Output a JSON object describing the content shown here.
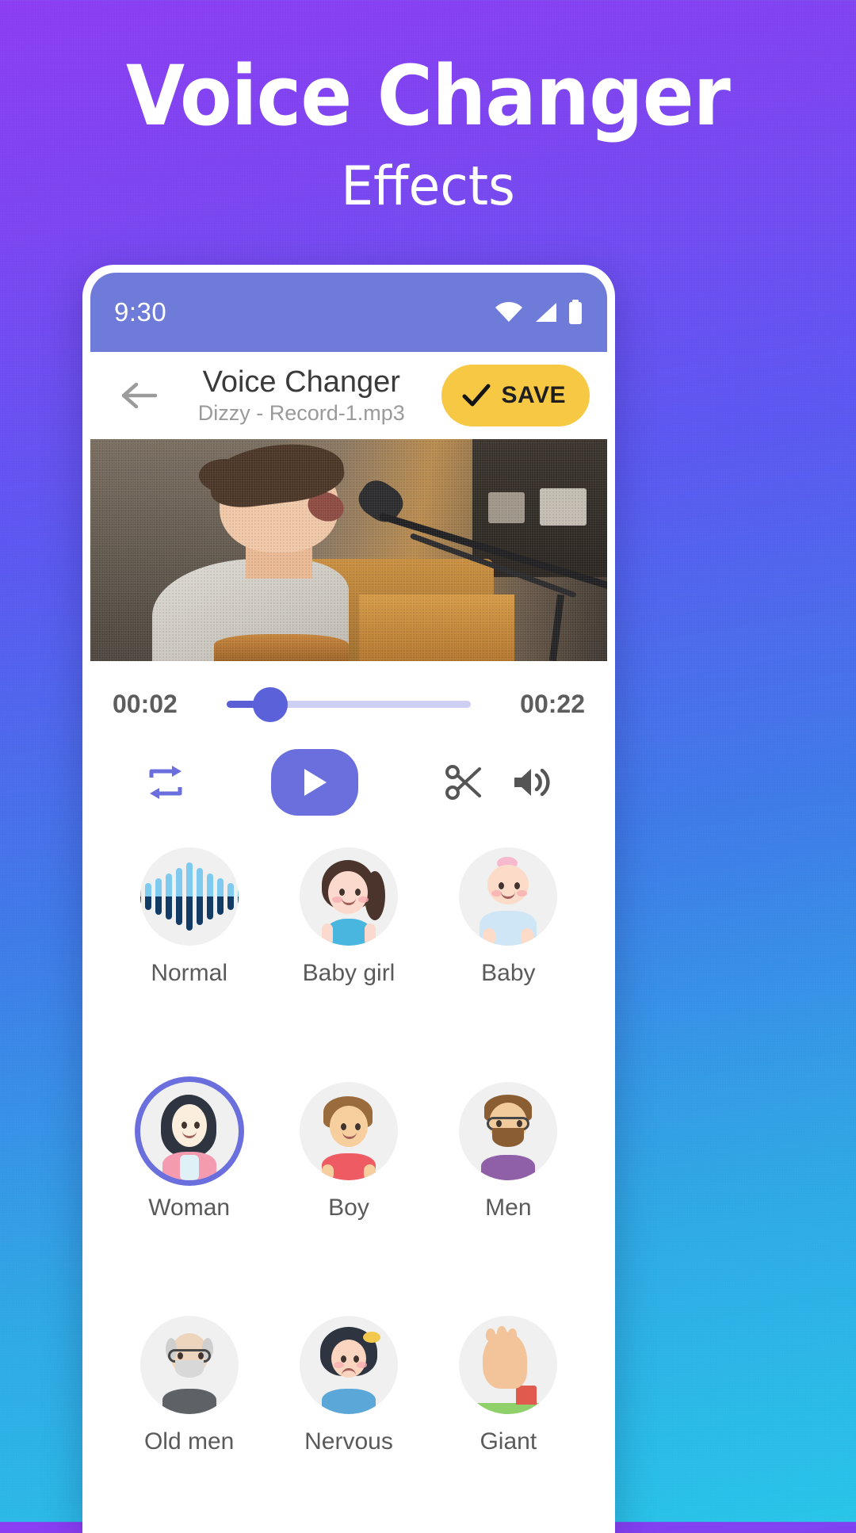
{
  "promo": {
    "title": "Voice Changer",
    "subtitle": "Effects"
  },
  "colors": {
    "bg_top": "#8b3df2",
    "bg_bottom": "#27c4e8",
    "accent_purple": "#6b6fdd",
    "save_yellow": "#f7c843",
    "status_bar": "#6f7bd8",
    "track_filled": "#5a5fd6",
    "track_empty": "#cdd0f3"
  },
  "status_bar": {
    "time": "9:30",
    "icons": [
      "wifi-icon",
      "signal-icon",
      "battery-icon"
    ]
  },
  "appbar": {
    "back_icon": "back-arrow-icon",
    "title": "Voice Changer",
    "subtitle": "Dizzy - Record-1.mp3",
    "save_label": "SAVE",
    "save_icon": "check-icon"
  },
  "player": {
    "current_time": "00:02",
    "total_time": "00:22",
    "progress_percent": 18,
    "controls": [
      {
        "name": "repeat-button",
        "icon": "repeat-icon"
      },
      {
        "name": "play-button",
        "icon": "play-icon"
      },
      {
        "name": "trim-button",
        "icon": "scissors-icon"
      },
      {
        "name": "volume-button",
        "icon": "volume-icon"
      }
    ]
  },
  "effects": {
    "selected": "Woman",
    "items": [
      {
        "label": "Normal",
        "icon": "waveform-icon",
        "selected": false
      },
      {
        "label": "Baby girl",
        "icon": "baby-girl-icon",
        "selected": false
      },
      {
        "label": "Baby",
        "icon": "baby-icon",
        "selected": false
      },
      {
        "label": "Woman",
        "icon": "woman-icon",
        "selected": true
      },
      {
        "label": "Boy",
        "icon": "boy-icon",
        "selected": false
      },
      {
        "label": "Men",
        "icon": "men-icon",
        "selected": false
      },
      {
        "label": "Old men",
        "icon": "old-men-icon",
        "selected": false
      },
      {
        "label": "Nervous",
        "icon": "nervous-icon",
        "selected": false
      },
      {
        "label": "Giant",
        "icon": "giant-icon",
        "selected": false
      }
    ]
  }
}
